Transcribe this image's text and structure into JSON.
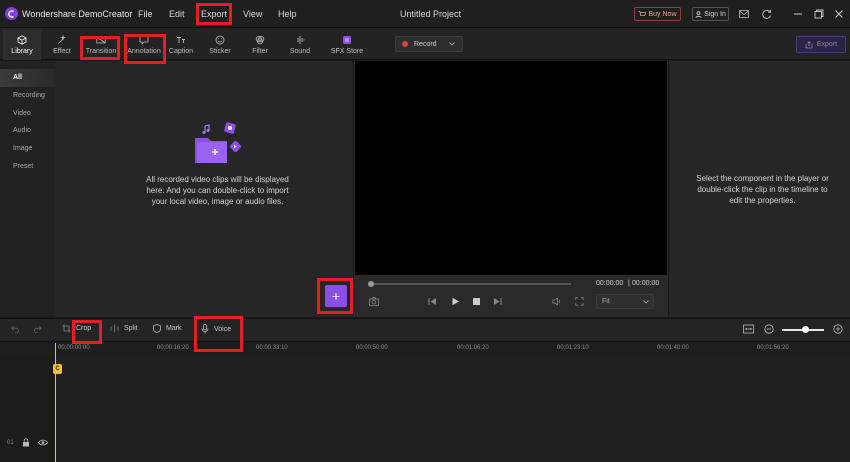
{
  "titlebar": {
    "app_title": "Wondershare DemoCreator",
    "menu": [
      "File",
      "Edit",
      "Export",
      "View",
      "Help"
    ],
    "project_title": "Untitled Project",
    "buy_now": "Buy Now",
    "sign_in": "Sign In"
  },
  "toolbar": {
    "tabs": [
      "Library",
      "Effect",
      "Transition",
      "Annotation",
      "Caption",
      "Sticker",
      "Filter",
      "Sound",
      "SFX Store"
    ],
    "record": "Record",
    "export": "Export"
  },
  "sidebar": {
    "items": [
      "All",
      "Recording",
      "Video",
      "Audio",
      "Image",
      "Preset"
    ]
  },
  "library": {
    "empty_message": "All recorded video clips will be displayed here. And you can double-click to import your local video, image or audio files."
  },
  "player": {
    "current_time": "00:00:00",
    "total_time": "00:00:00",
    "fit": "Fit"
  },
  "properties": {
    "hint": "Select the component in the player or double-click the clip in the timeline to edit the properties."
  },
  "timeline": {
    "tools": [
      "Crop",
      "Split",
      "Mark",
      "Voice"
    ],
    "ruler": [
      "00:00:00:00",
      "00:00:16:20",
      "00:00:33:10",
      "00:00:50:00",
      "00:01:06:20",
      "00:01:23:10",
      "00:01:40:00",
      "00:01:56:20"
    ],
    "track_number": "01"
  },
  "colors": {
    "accent": "#8a4fe6",
    "highlight": "#e41e26",
    "playhead": "#f0c232"
  }
}
